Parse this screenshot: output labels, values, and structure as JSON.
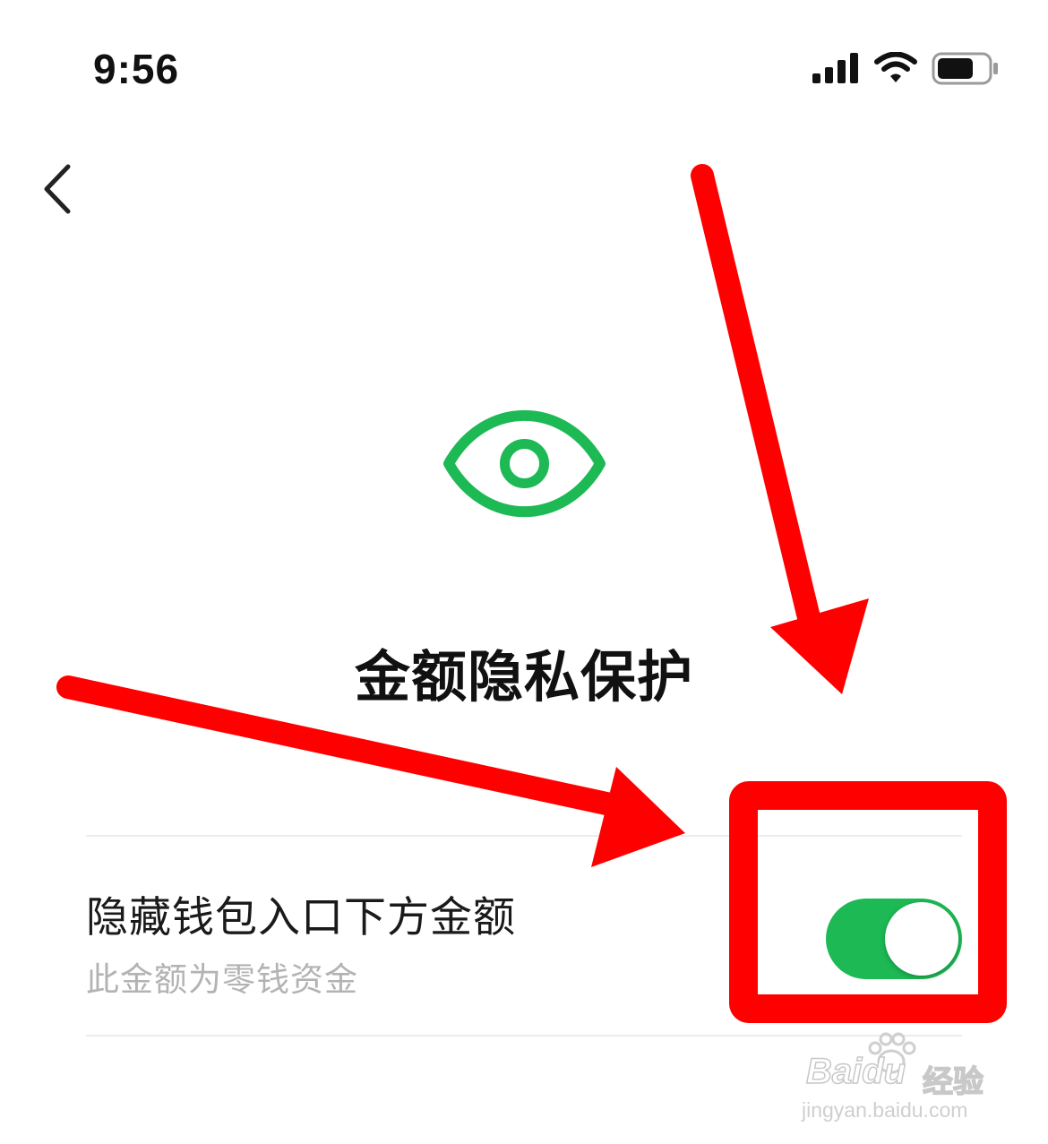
{
  "status_bar": {
    "time": "9:56",
    "icons": [
      "cellular-signal-icon",
      "wifi-icon",
      "battery-icon"
    ]
  },
  "nav": {
    "back_icon": "chevron-left-icon"
  },
  "hero": {
    "icon": "eye-icon",
    "icon_color": "#1db954",
    "title": "金额隐私保护"
  },
  "setting": {
    "title": "隐藏钱包入口下方金额",
    "description": "此金额为零钱资金",
    "toggle_on": true,
    "toggle_color": "#1db954"
  },
  "annotations": {
    "color": "#ff0000",
    "highlight": "toggle-switch",
    "arrows": 2
  },
  "watermark": {
    "brand": "Baidu",
    "text": "经验",
    "url": "jingyan.baidu.com"
  }
}
